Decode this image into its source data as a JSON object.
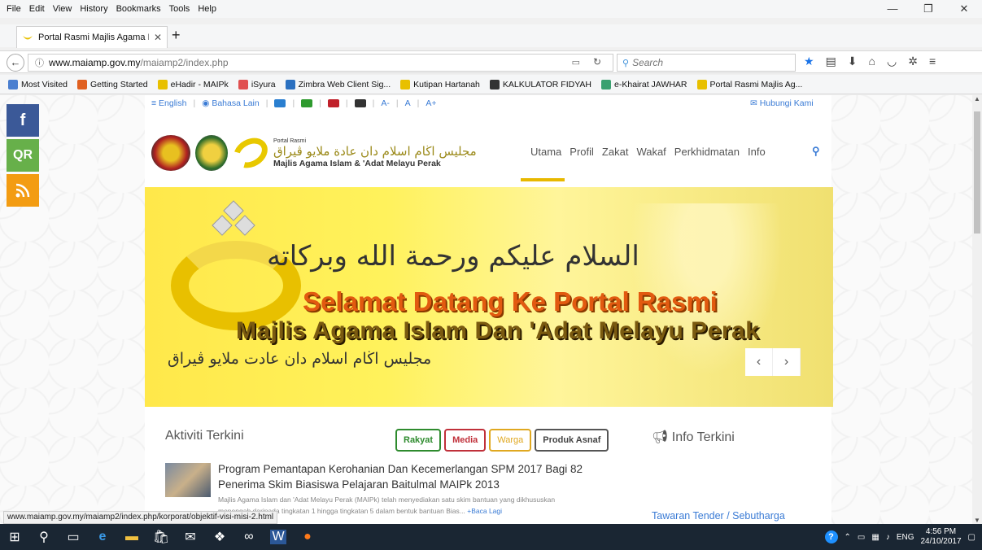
{
  "menu": [
    "File",
    "Edit",
    "View",
    "History",
    "Bookmarks",
    "Tools",
    "Help"
  ],
  "window_controls": [
    "—",
    "❐",
    "✕"
  ],
  "tab": {
    "title": "Portal Rasmi Majlis Agama I",
    "close": "✕"
  },
  "newtab_label": "+",
  "nav": {
    "url_host": "www.maiamp.gov.my",
    "url_path": "/maiamp2/index.php",
    "search_placeholder": "Search"
  },
  "bookmarks": [
    {
      "label": "Most Visited",
      "color": "#4a7fd0"
    },
    {
      "label": "Getting Started",
      "color": "#e06020"
    },
    {
      "label": "eHadir - MAIPk",
      "color": "#e8c000"
    },
    {
      "label": "iSyura",
      "color": "#e05050"
    },
    {
      "label": "Zimbra Web Client Sig...",
      "color": "#2a70c0"
    },
    {
      "label": "Kutipan Hartanah",
      "color": "#e8c000"
    },
    {
      "label": "KALKULATOR FIDYAH",
      "color": "#333333"
    },
    {
      "label": "e-Khairat JAWHAR",
      "color": "#3aa070"
    },
    {
      "label": "Portal Rasmi Majlis Ag...",
      "color": "#e8c000"
    }
  ],
  "page": {
    "util": {
      "english": "English",
      "bahasa": "Bahasa Lain",
      "color_squares": [
        "#2a7fd0",
        "#2e9a2e",
        "#c0202a",
        "#333333"
      ],
      "font_minus": "A-",
      "font_normal": "A",
      "font_plus": "A+",
      "contact": "Hubungi Kami"
    },
    "logo": {
      "small": "Portal Rasmi",
      "arabic": "مجليس اڬام اسلام دان عادة ملايو ڤيراق",
      "name": "Majlis Agama Islam & 'Adat Melayu Perak"
    },
    "mainnav": [
      "Utama",
      "Profil",
      "Zakat",
      "Wakaf",
      "Perkhidmatan",
      "Info"
    ],
    "slider": {
      "calligraphy": "السلام عليكم ورحمة الله وبركاته",
      "welcome1": "Selamat Datang Ke Portal Rasmi",
      "welcome2": "Majlis Agama Islam Dan 'Adat Melayu Perak",
      "arabic_bottom": "مجليس اڬام اسلام دان عادت ملايو ڤيراق",
      "prev": "‹",
      "next": "›"
    },
    "aktiviti_title": "Aktiviti Terkini",
    "filters": [
      "Rakyat",
      "Media",
      "Warga",
      "Produk Asnaf"
    ],
    "info_title": "Info Terkini",
    "news": {
      "title": "Program Pemantapan Kerohanian Dan Kecemerlangan SPM 2017 Bagi 82 Penerima Skim Biasiswa Pelajaran Baitulmal MAIPk 2013",
      "desc": "Majlis Agama Islam dan 'Adat Melayu Perak (MAIPk) telah menyediakan satu skim bantuan yang dikhususkan",
      "desc2": "menengah daripada tingkatan 1 hingga tingkatan 5 dalam bentuk bantuan Bias...",
      "baca": "+Baca Lagi"
    },
    "tender": "Tawaran Tender / Sebutharga"
  },
  "social": [
    "f",
    "QR",
    "RSS"
  ],
  "status_url": "www.maiamp.gov.my/maiamp2/index.php/korporat/objektif-visi-misi-2.html",
  "taskbar": {
    "lang": "ENG",
    "time": "4:56 PM",
    "date": "24/10/2017"
  }
}
